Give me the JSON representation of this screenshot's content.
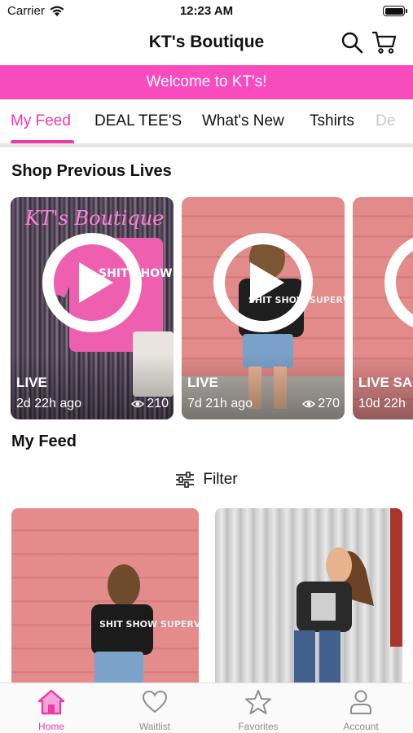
{
  "status_bar": {
    "carrier": "Carrier",
    "time": "12:23 AM"
  },
  "header": {
    "title": "KT's Boutique"
  },
  "banner": {
    "text": "Welcome to KT's!"
  },
  "tabs": [
    {
      "label": "My Feed",
      "active": true
    },
    {
      "label": "DEAL TEE'S",
      "active": false
    },
    {
      "label": "What's New",
      "active": false
    },
    {
      "label": "Tshirts",
      "active": false
    },
    {
      "label": "De",
      "active": false
    }
  ],
  "previous_lives": {
    "title": "Shop Previous Lives",
    "cards": [
      {
        "label": "LIVE",
        "ago": "2d 22h ago",
        "views": "210",
        "neon_text": "KT's Boutique",
        "shirt_text": "SHIT SHOW BESTIE"
      },
      {
        "label": "LIVE",
        "ago": "7d 21h ago",
        "views": "270",
        "shirt_text": "SHIT SHOW SUPERVISOR"
      },
      {
        "label": "LIVE SAL",
        "ago": "10d 22h"
      }
    ]
  },
  "feed": {
    "title": "My Feed",
    "filter_label": "Filter",
    "items": [
      {
        "shirt_text": "SHIT SHOW SUPERVISOR"
      },
      {
        "shirt_text": ""
      }
    ]
  },
  "bottom_nav": [
    {
      "label": "Home",
      "icon": "home-icon",
      "active": true
    },
    {
      "label": "Waitlist",
      "icon": "heart-icon",
      "active": false
    },
    {
      "label": "Favorites",
      "icon": "star-icon",
      "active": false
    },
    {
      "label": "Account",
      "icon": "person-icon",
      "active": false
    }
  ],
  "colors": {
    "accent": "#ec3aa9",
    "banner": "#f84bbe"
  }
}
